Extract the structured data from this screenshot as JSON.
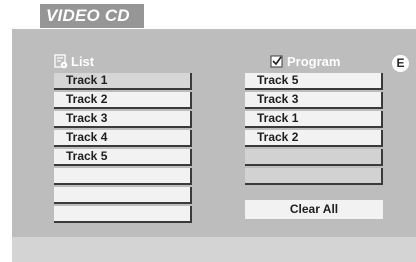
{
  "mode_label": "VIDEO CD",
  "list_panel": {
    "title": "List",
    "icon": "list-disc-icon",
    "rows": [
      "Track 1",
      "Track 2",
      "Track 3",
      "Track 4",
      "Track 5",
      "",
      "",
      ""
    ],
    "selected_index": 0
  },
  "program_panel": {
    "title": "Program",
    "icon": "checkbox-checked-icon",
    "rows": [
      "Track 5",
      "Track 3",
      "Track 1",
      "Track 2",
      "",
      ""
    ]
  },
  "badge": "E",
  "clear_all_label": "Clear All",
  "colors": {
    "panel_bg": "#bdbdbd",
    "row_bg": "#f2f2f2",
    "selected_row_bg": "#d6d6d6",
    "row_shadow": "#3a3a3a",
    "label_bg": "#969696"
  }
}
